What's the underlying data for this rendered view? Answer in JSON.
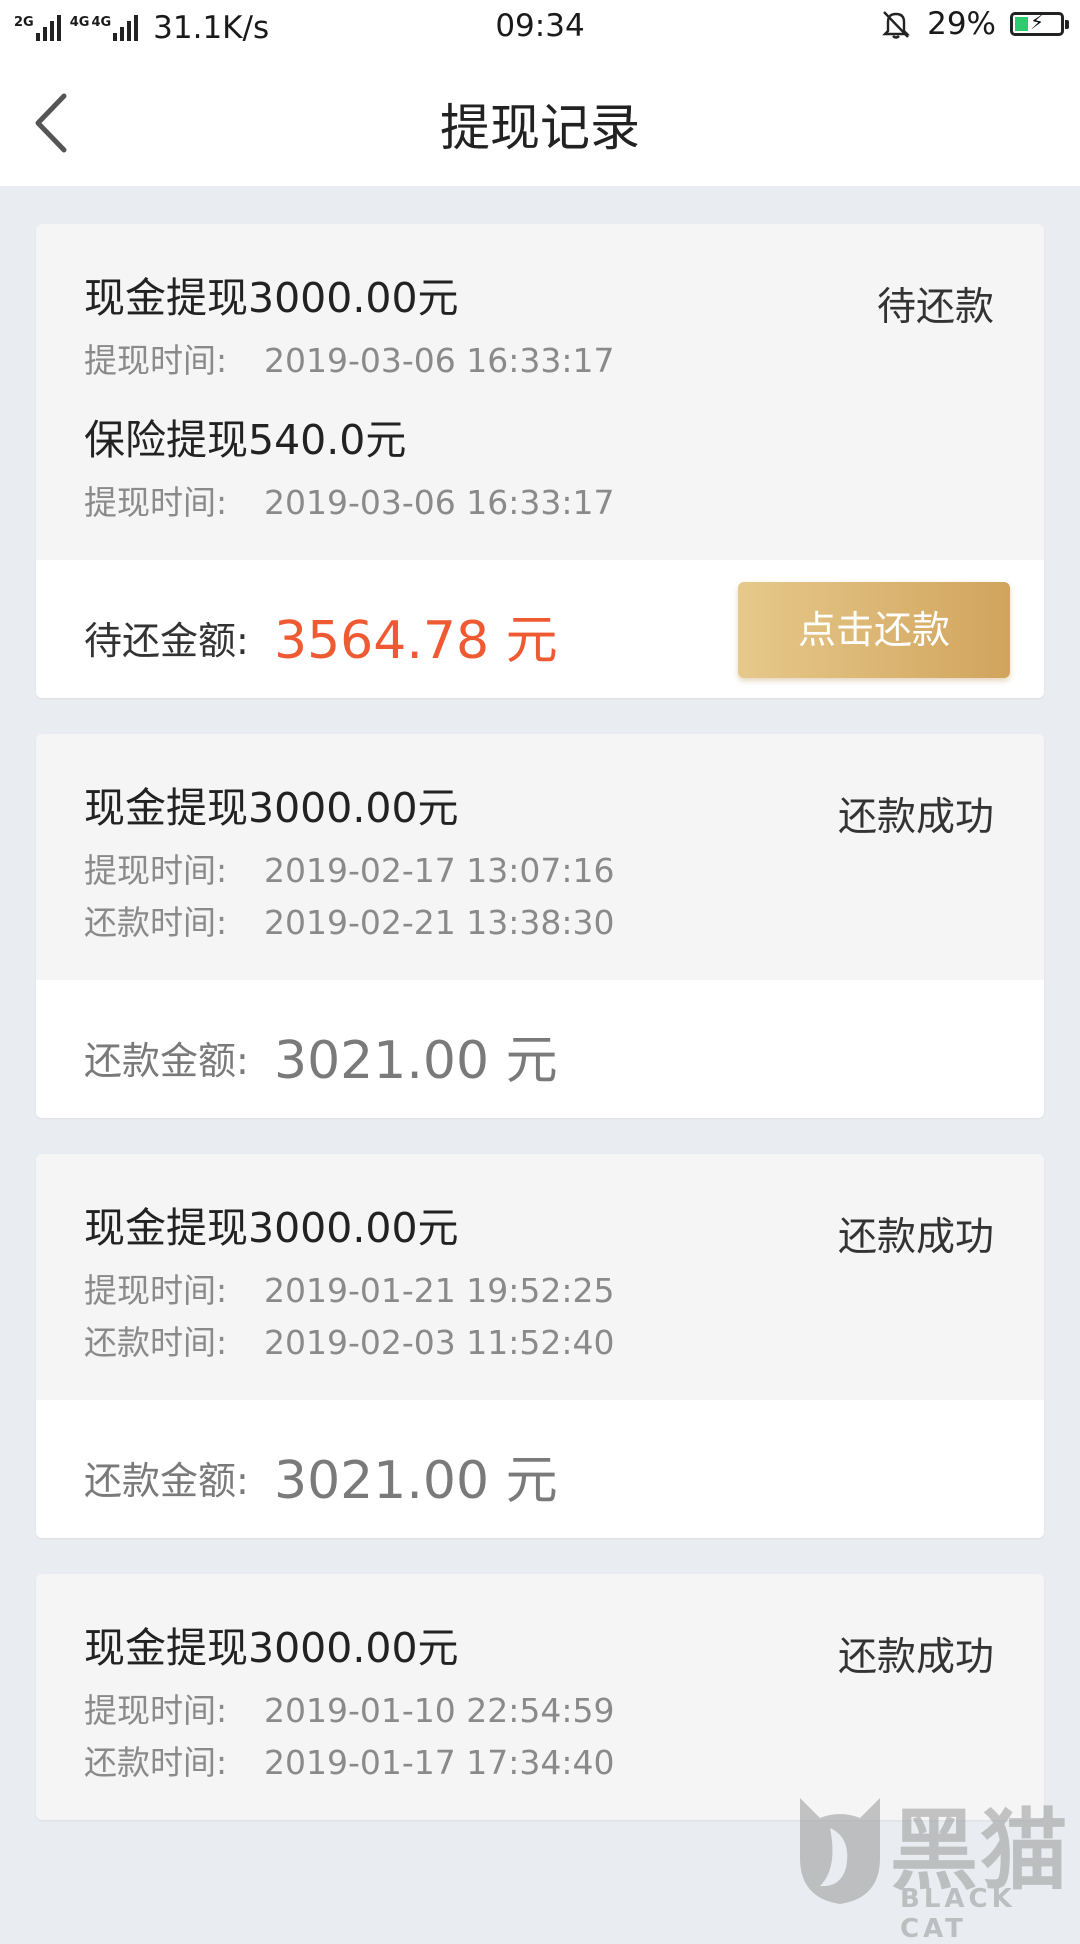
{
  "status_bar": {
    "net_tag_1": "2G",
    "net_tag_2": "4G",
    "net_tag_3": "4G",
    "net_speed": "31.1K/s",
    "time": "09:34",
    "battery_percent_label": "29%",
    "battery_level": 0.29
  },
  "nav": {
    "title": "提现记录",
    "back_icon": "chevron-left-icon"
  },
  "records": [
    {
      "title": "现金提现3000.00元",
      "status": "待还款",
      "withdraw_time_label": "提现时间:",
      "withdraw_time": "2019-03-06 16:33:17",
      "extra_title": "保险提现540.0元",
      "extra_time_label": "提现时间:",
      "extra_time": "2019-03-06 16:33:17",
      "amount_label": "待还金额:",
      "amount_value": "3564.78 元",
      "button_label": "点击还款"
    },
    {
      "title": "现金提现3000.00元",
      "status": "还款成功",
      "withdraw_time_label": "提现时间:",
      "withdraw_time": "2019-02-17 13:07:16",
      "repay_time_label": "还款时间:",
      "repay_time": "2019-02-21 13:38:30",
      "amount_label": "还款金额:",
      "amount_value": "3021.00 元"
    },
    {
      "title": "现金提现3000.00元",
      "status": "还款成功",
      "withdraw_time_label": "提现时间:",
      "withdraw_time": "2019-01-21 19:52:25",
      "repay_time_label": "还款时间:",
      "repay_time": "2019-02-03 11:52:40",
      "amount_label": "还款金额:",
      "amount_value": "3021.00 元"
    },
    {
      "title": "现金提现3000.00元",
      "status": "还款成功",
      "withdraw_time_label": "提现时间:",
      "withdraw_time": "2019-01-10 22:54:59",
      "repay_time_label": "还款时间:",
      "repay_time": "2019-01-17 17:34:40"
    }
  ],
  "watermark": {
    "text": "黑猫",
    "sub": "BLACK CAT"
  },
  "colors": {
    "accent_red": "#ef5a33",
    "button_gold": "#d9b26e",
    "battery_green": "#2ecc71"
  }
}
